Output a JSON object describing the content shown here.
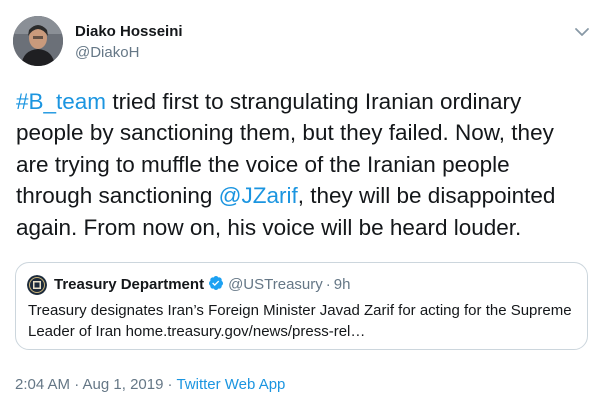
{
  "author": {
    "name": "Diako Hosseini",
    "handle": "@DiakoH"
  },
  "tweet": {
    "hashtag": "#B_team",
    "text_1": " tried first to strangulating Iranian ordinary\npeople by sanctioning them, but they failed. Now, they\nare trying to muffle the voice of the Iranian people\nthrough sanctioning ",
    "mention": "@JZarif",
    "text_2": ", they will be disappointed\nagain. From now on, his voice will be heard louder."
  },
  "quote": {
    "name": "Treasury Department",
    "handle": "@USTreasury",
    "time": "9h",
    "separator": "·",
    "text": "Treasury designates Iran’s Foreign Minister Javad Zarif for acting for the Supreme\nLeader of Iran home.treasury.gov/news/press-rel…"
  },
  "footer": {
    "timestamp": "2:04 AM · Aug 1, 2019",
    "separator": "·",
    "source": "Twitter Web App"
  },
  "colors": {
    "link": "#1b95e0",
    "secondary_text": "#657786",
    "border": "#ccd6dd",
    "verified": "#1da1f2"
  },
  "icons": {
    "caret": "chevron-down-icon",
    "verified": "verified-badge-icon",
    "quote_avatar": "treasury-seal-icon"
  }
}
